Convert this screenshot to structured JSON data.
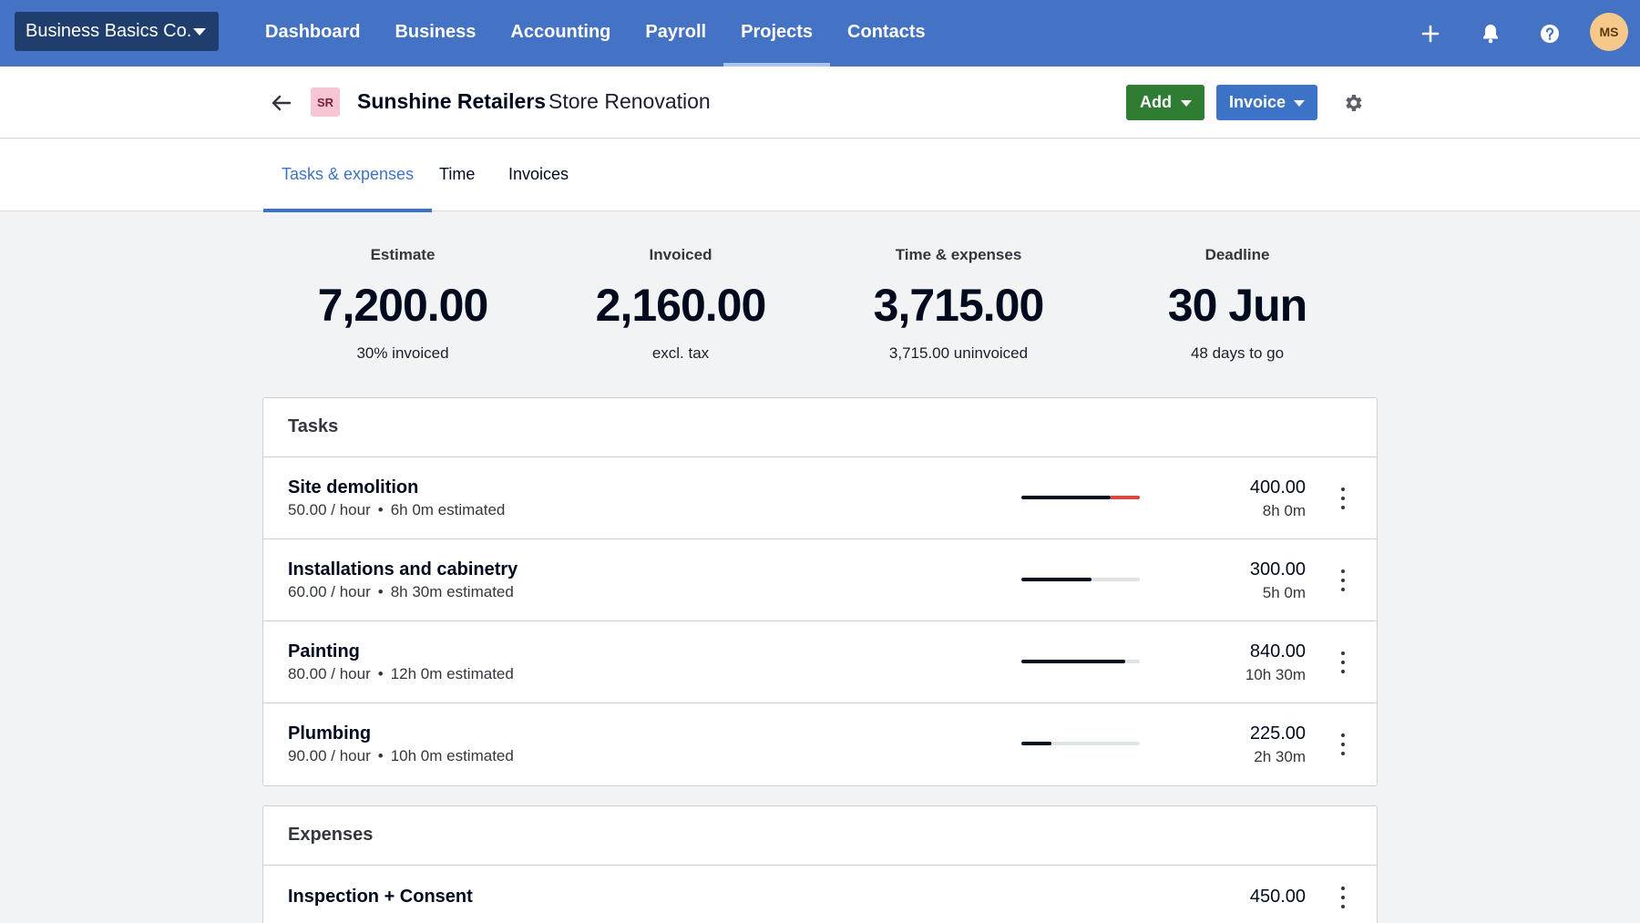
{
  "org": {
    "name": "Business Basics Co."
  },
  "nav": {
    "items": [
      "Dashboard",
      "Business",
      "Accounting",
      "Payroll",
      "Projects",
      "Contacts"
    ],
    "active": "Projects",
    "user_initials": "MS"
  },
  "project": {
    "contact_initials": "SR",
    "contact_name": "Sunshine Retailers",
    "name": "Store Renovation",
    "add_label": "Add",
    "invoice_label": "Invoice"
  },
  "tabs": [
    "Tasks & expenses",
    "Time",
    "Invoices"
  ],
  "stats": [
    {
      "label": "Estimate",
      "value": "7,200.00",
      "sub": "30% invoiced"
    },
    {
      "label": "Invoiced",
      "value": "2,160.00",
      "sub": "excl. tax"
    },
    {
      "label": "Time & expenses",
      "value": "3,715.00",
      "sub": "3,715.00 uninvoiced"
    },
    {
      "label": "Deadline",
      "value": "30 Jun",
      "sub": "48 days to go"
    }
  ],
  "tasks": {
    "heading": "Tasks",
    "rows": [
      {
        "name": "Site demolition",
        "rate": "50.00 / hour",
        "estimate": "6h 0m estimated",
        "amount": "400.00",
        "hours": "8h 0m",
        "progress": 0.75,
        "over": 0.25
      },
      {
        "name": "Installations and cabinetry",
        "rate": "60.00 / hour",
        "estimate": "8h 30m estimated",
        "amount": "300.00",
        "hours": "5h 0m",
        "progress": 0.59,
        "over": 0
      },
      {
        "name": "Painting",
        "rate": "80.00 / hour",
        "estimate": "12h 0m estimated",
        "amount": "840.00",
        "hours": "10h 30m",
        "progress": 0.875,
        "over": 0
      },
      {
        "name": "Plumbing",
        "rate": "90.00 / hour",
        "estimate": "10h 0m estimated",
        "amount": "225.00",
        "hours": "2h 30m",
        "progress": 0.25,
        "over": 0
      }
    ]
  },
  "expenses": {
    "heading": "Expenses",
    "rows": [
      {
        "name": "Inspection + Consent",
        "amount": "450.00"
      }
    ]
  },
  "colors": {
    "nav_bg": "#4472c4",
    "add_button": "#2e7d32",
    "invoice_button": "#3d73c7",
    "over_budget": "#d9473d"
  },
  "icons": [
    "plus-icon",
    "bell-icon",
    "help-icon",
    "back-arrow-icon",
    "gear-icon",
    "more-vertical-icon"
  ]
}
